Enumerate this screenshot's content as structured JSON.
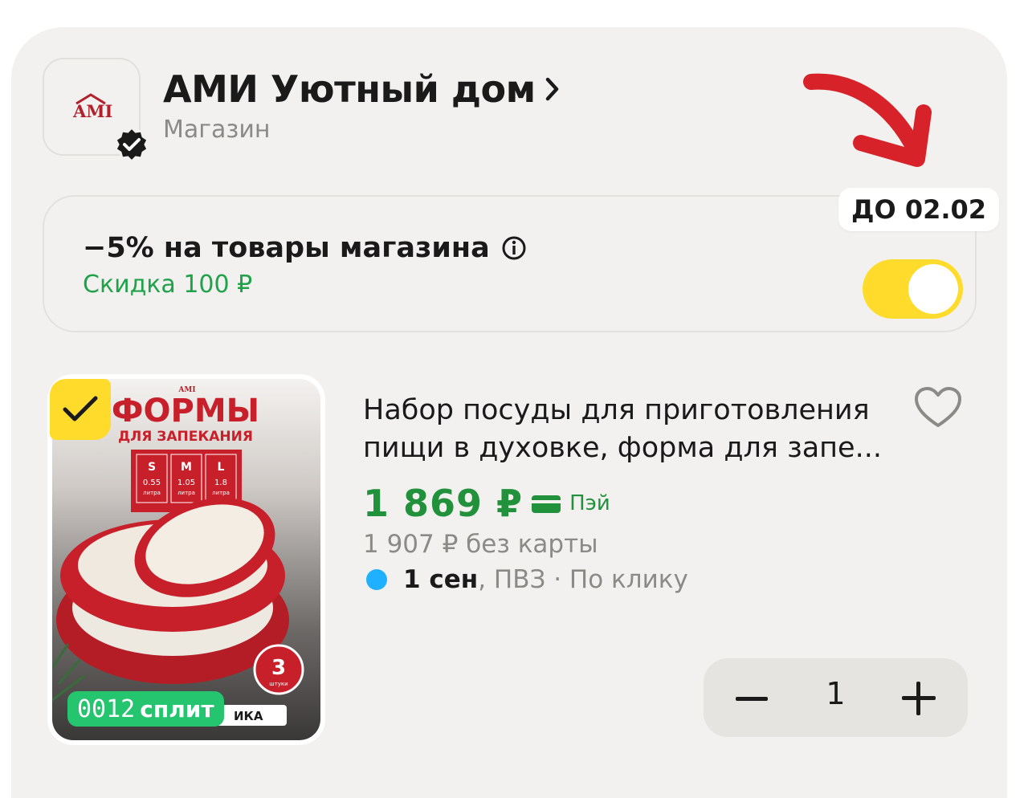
{
  "shop": {
    "name": "АМИ Уютный дом",
    "type": "Магазин",
    "logo_text": "AMI"
  },
  "promo": {
    "title": "−5% на товары магазина",
    "subtitle": "Скидка 100 ₽",
    "deadline": "ДО 02.02",
    "toggle_on": true
  },
  "product": {
    "name": "Набор посуды для приготовления пищи в духовке, форма для запе...",
    "price": "1 869 ₽",
    "pay_label": "Пэй",
    "old_price": "1 907 ₽  без карты",
    "delivery_date": "1 сен",
    "delivery_rest": ", ПВЗ · По клику",
    "split_amount": "0012",
    "split_label": "сплит",
    "selected": true,
    "quantity": "1",
    "image_text": {
      "brand": "AMI",
      "title": "ФОРМЫ",
      "subtitle": "ДЛЯ ЗАПЕКАНИЯ",
      "sizes": [
        {
          "size": "S",
          "volume": "0.55",
          "unit": "литра"
        },
        {
          "size": "M",
          "volume": "1.05",
          "unit": "литра"
        },
        {
          "size": "L",
          "volume": "1.8",
          "unit": "литра"
        }
      ],
      "count": "3",
      "count_unit": "штуки",
      "bottom_label": "ИКА"
    }
  },
  "colors": {
    "accent_yellow": "#ffdb2b",
    "price_green": "#21913c",
    "discount_green": "#1fa24a",
    "split_green": "#25c46e",
    "brand_red": "#b0212b",
    "annotation_red": "#d7222a",
    "delivery_blue": "#1fb1ff"
  }
}
